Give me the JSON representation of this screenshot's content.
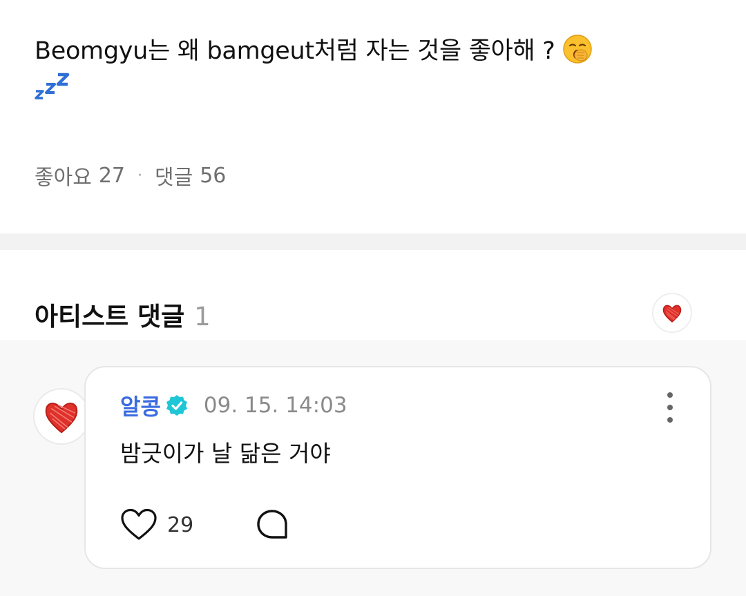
{
  "post": {
    "text": "Beomgyu는 왜 bamgeut처럼 자는 것을 좋아해 ?",
    "icons": [
      "yawning-face-emoji",
      "zzz-emoji"
    ]
  },
  "stats": {
    "likes_label": "좋아요",
    "likes_count": "27",
    "separator": "·",
    "comments_label": "댓글",
    "comments_count": "56"
  },
  "artist_comments": {
    "title": "아티스트 댓글",
    "count": "1",
    "filter_icon": "red-heart-icon"
  },
  "comment": {
    "author": "알콩",
    "verified_icon": "verified-badge-icon",
    "timestamp": "09. 15. 14:03",
    "text": "밤긋이가 날 닮은 거야",
    "like_count": "29",
    "avatar_icon": "red-heart-avatar"
  },
  "colors": {
    "author_blue": "#3a6be0",
    "verified_cyan": "#1fc6d6",
    "heart_red": "#e0302a",
    "muted_gray": "#6f6f6f"
  }
}
